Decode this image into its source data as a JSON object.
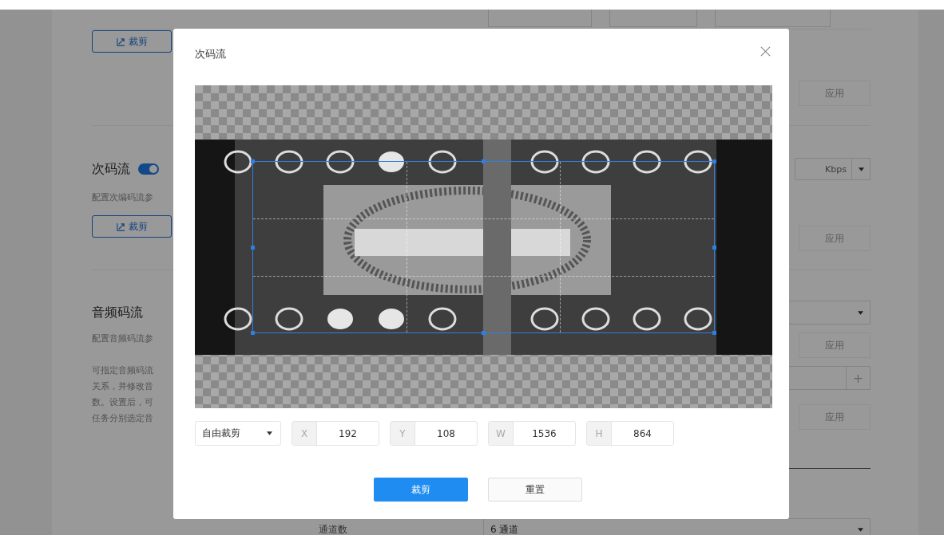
{
  "page": {
    "main_stream": {
      "crop_button": "裁剪",
      "apply_button": "应用"
    },
    "sub_stream": {
      "title": "次码流",
      "enabled": true,
      "description": "配置次编码流参",
      "crop_button": "裁剪",
      "bitrate_unit": "Kbps",
      "apply_button": "应用"
    },
    "audio_stream": {
      "title": "音频码流",
      "description": "配置音频码流参",
      "apply_button": "应用",
      "note_lines": [
        "可指定音频码流",
        "关系，并修改音",
        "数。设置后，可",
        "任务分别选定音"
      ],
      "add_button": "+",
      "apply_button_2": "应用",
      "channels_label": "通道数",
      "channels_value": "6 通道"
    }
  },
  "dialog": {
    "title": "次码流",
    "crop_mode": "自由裁剪",
    "fields": [
      {
        "label": "X",
        "value": "192"
      },
      {
        "label": "Y",
        "value": "108"
      },
      {
        "label": "W",
        "value": "1536"
      },
      {
        "label": "H",
        "value": "864"
      }
    ],
    "buttons": [
      {
        "label": "裁剪",
        "kind": "primary"
      },
      {
        "label": "重置",
        "kind": "default"
      }
    ]
  }
}
